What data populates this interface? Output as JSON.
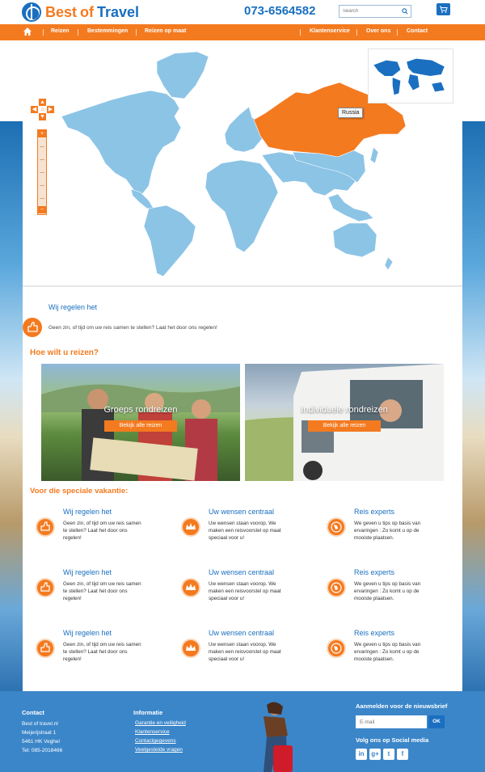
{
  "brand": {
    "best": "Best",
    "of": "of",
    "travel": "Travel"
  },
  "phone": "073-6564582",
  "search": {
    "placeholder": "Search"
  },
  "nav": {
    "items": [
      "Reizen",
      "Bestemmingen",
      "Reizen op maat",
      "Klantenservice",
      "Over ons",
      "Contact"
    ]
  },
  "map": {
    "tooltip": "Russia",
    "highlight_color": "#f47a1f",
    "land_color": "#8cc4e6"
  },
  "intro": {
    "title": "Wij regelen het",
    "text": "Geen zin, of tijd om uw reis samen te stellen? Laat het door ons regelen!"
  },
  "how_title": "Hoe wilt u reizen?",
  "cards": [
    {
      "title": "Groeps rondreizen",
      "button": "Bekijk alle reizen"
    },
    {
      "title": "Individuele rondreizen",
      "button": "Bekijk alle reizen"
    }
  ],
  "special_title": "Voor die speciale vakantie:",
  "features": [
    {
      "title": "Wij regelen het",
      "text": "Geen zin, of tijd om uw reis samen te stellen? Laat het door ons regelen!",
      "icon": "thumbs-up-icon"
    },
    {
      "title": "Uw wensen centraal",
      "text": "Uw wensen staan voorop. We maken een reisvoorstel op maat speciaal voor u!",
      "icon": "crown-icon"
    },
    {
      "title": "Reis experts",
      "text": "We geven u tips op basis van ervaringen : Zo komt u op de mooiste plaatsen.",
      "icon": "globe-icon"
    },
    {
      "title": "Wij regelen het",
      "text": "Geen zin, of tijd om uw reis samen te stellen? Laat het door ons regelen!",
      "icon": "thumbs-up-icon"
    },
    {
      "title": "Uw wensen centraal",
      "text": "Uw wensen staan voorop. We maken een reisvoorstel op maat speciaal voor u!",
      "icon": "crown-icon"
    },
    {
      "title": "Reis experts",
      "text": "We geven u tips op basis van ervaringen : Zo komt u op de mooiste plaatsen.",
      "icon": "globe-icon"
    },
    {
      "title": "Wij regelen het",
      "text": "Geen zin, of tijd om uw reis samen te stellen? Laat het door ons regelen!",
      "icon": "thumbs-up-icon"
    },
    {
      "title": "Uw wensen centraal",
      "text": "Uw wensen staan voorop. We maken een reisvoorstel op maat speciaal voor u!",
      "icon": "crown-icon"
    },
    {
      "title": "Reis experts",
      "text": "We geven u tips op basis van ervaringen : Zo komt u op de mooiste plaatsen.",
      "icon": "globe-icon"
    }
  ],
  "footer": {
    "contact": {
      "title": "Contact",
      "lines": [
        "Best of travel.nl",
        "Meijerijstraat 1",
        "5461 HK Veghel",
        "Tel: 085-2018466"
      ]
    },
    "info": {
      "title": "Informatie",
      "links": [
        "Garantie en veiligheid",
        "Klantenservice",
        "Contactgegevens",
        "Veelgestelde vragen"
      ]
    },
    "newsletter": {
      "title": "Aanmelden voor de nieuwsbrief",
      "placeholder": "E-mail",
      "button": "OK"
    },
    "social": {
      "title": "Volg ons op Social media",
      "icons": [
        "in",
        "g+",
        "t",
        "f"
      ]
    }
  },
  "colors": {
    "orange": "#f47a1f",
    "blue": "#1a6fc0",
    "footer": "#3b86c9"
  }
}
